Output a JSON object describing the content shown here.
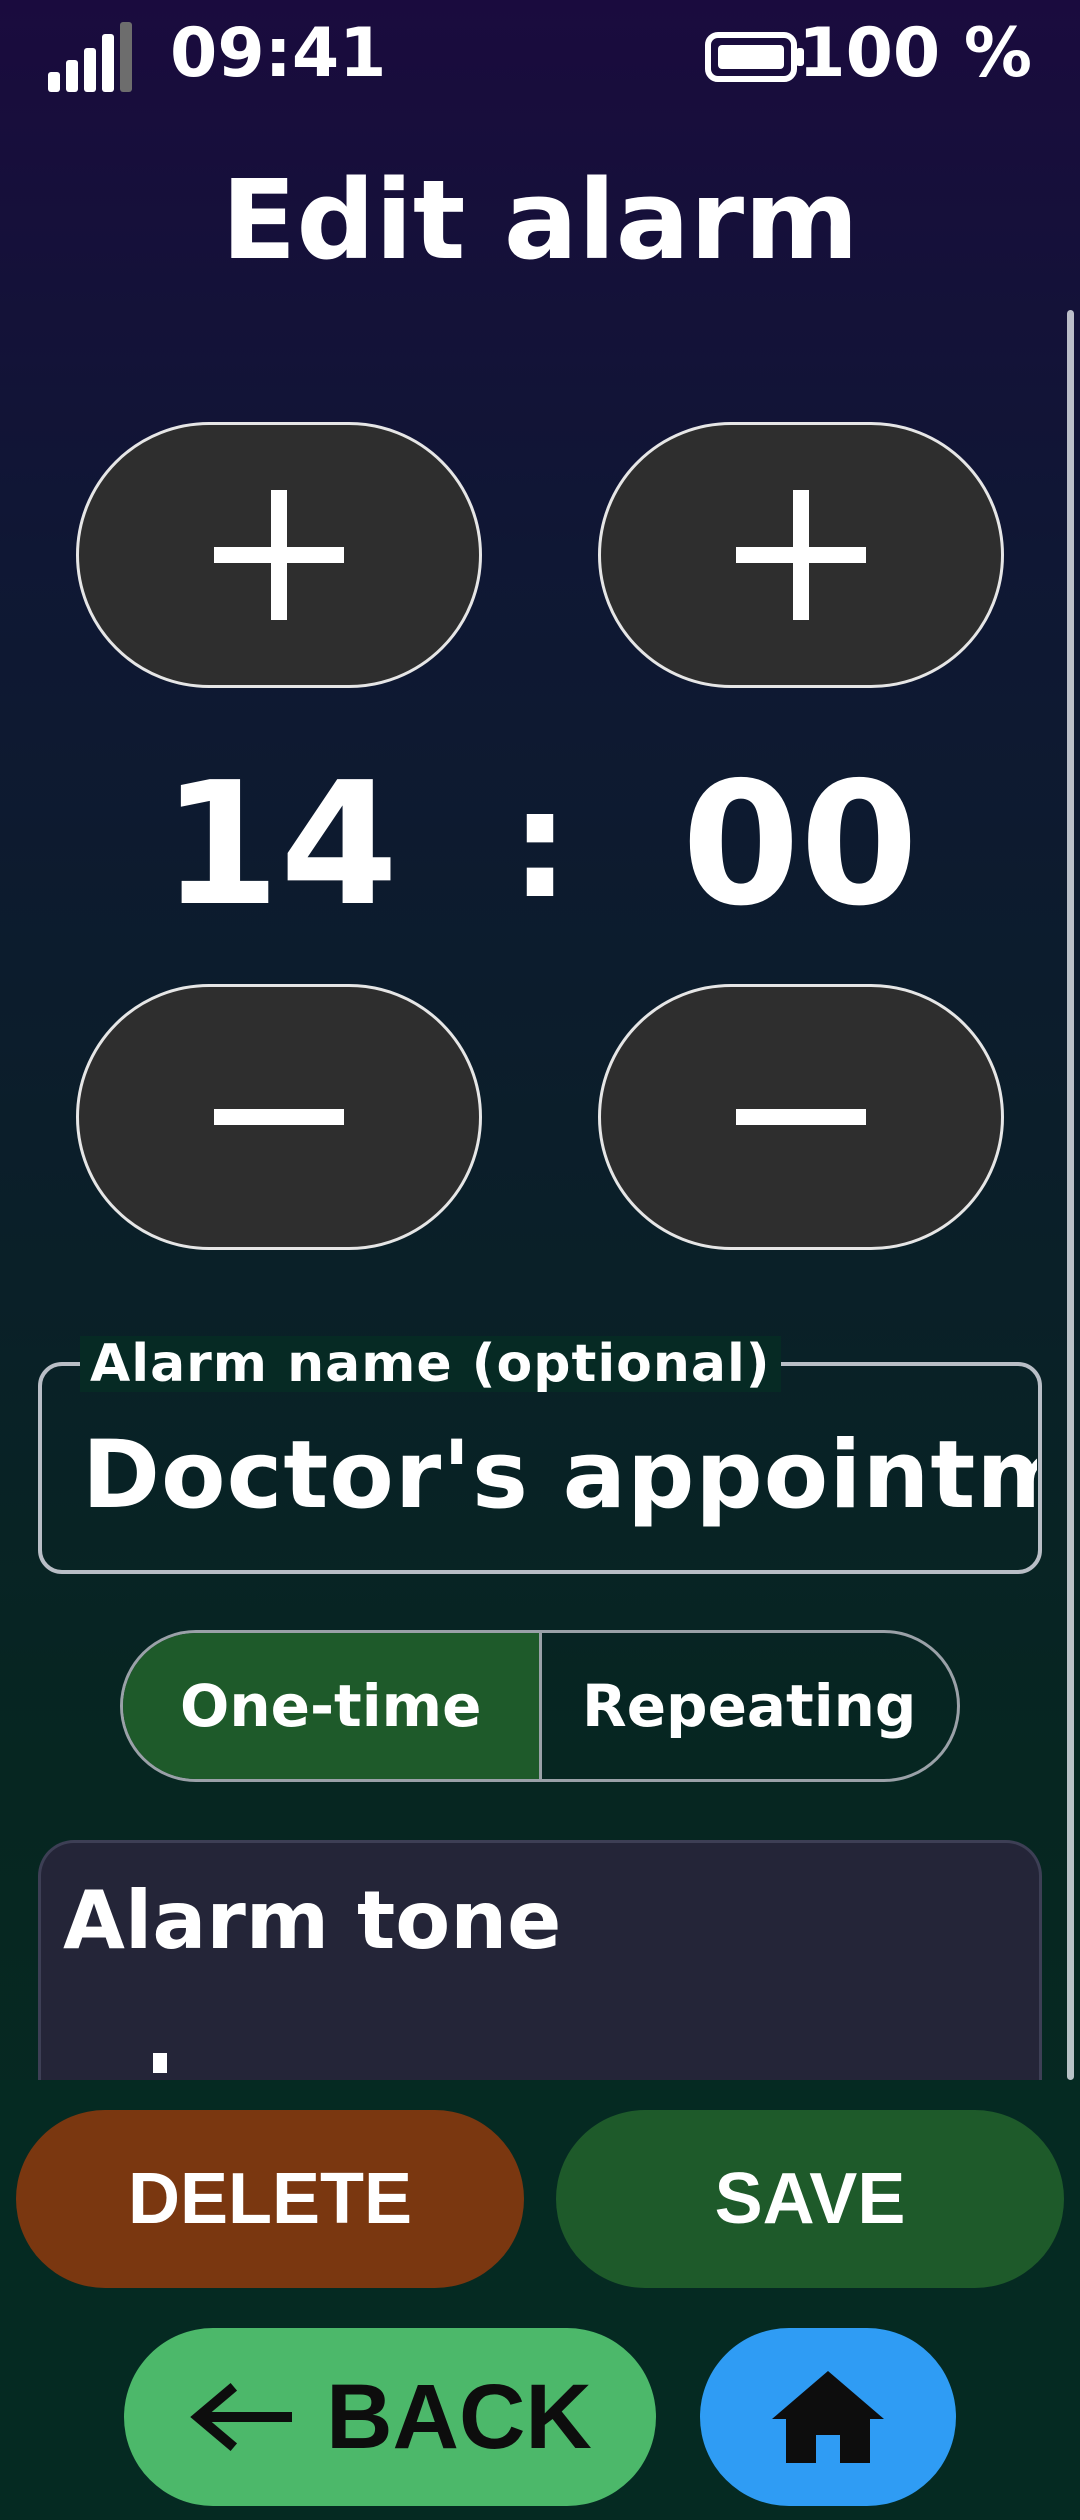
{
  "status_bar": {
    "time": "09:41",
    "battery": "100 %",
    "icons": [
      "signal-icon",
      "battery-icon"
    ]
  },
  "title": "Edit alarm",
  "time_picker": {
    "hour": "14",
    "separator": ":",
    "minute": "00"
  },
  "name_field": {
    "label": "Alarm name (optional)",
    "value": "Doctor's appointment"
  },
  "alarm_type": {
    "options": [
      "One-time",
      "Repeating"
    ],
    "selected": "One-time"
  },
  "tone_section": {
    "title": "Alarm tone"
  },
  "actions": {
    "delete": "DELETE",
    "save": "SAVE",
    "back": "BACK",
    "back_icon": "arrow-left-icon",
    "home_icon": "home-icon"
  },
  "colors": {
    "delete": "#7a3710",
    "save": "#1e5a2a",
    "back": "#4cb86a",
    "home": "#2f9cf4",
    "selected_segment": "#1e5a2a"
  }
}
